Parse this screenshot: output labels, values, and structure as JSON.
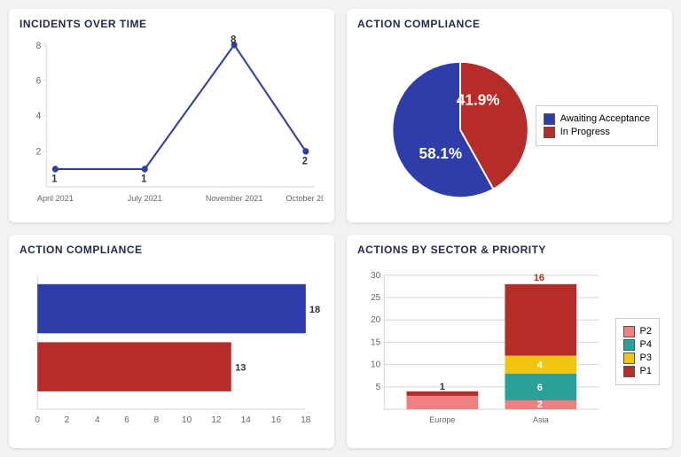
{
  "cards": {
    "incidents_over_time": {
      "title": "INCIDENTS OVER TIME"
    },
    "action_compliance_pie": {
      "title": "ACTION COMPLIANCE"
    },
    "action_compliance_bar": {
      "title": "ACTION COMPLIANCE"
    },
    "actions_by_sector": {
      "title": "ACTIONS BY SECTOR & PRIORITY"
    }
  },
  "pie_legend": {
    "awaiting": "Awaiting Acceptance",
    "in_progress": "In Progress"
  },
  "stack_legend": {
    "p1": "P1",
    "p2": "P2",
    "p3": "P3",
    "p4": "P4"
  },
  "chart_data": [
    {
      "type": "line",
      "title": "INCIDENTS OVER TIME",
      "categories": [
        "April 2021",
        "July 2021",
        "November 2021",
        "October 20"
      ],
      "values": [
        1,
        1,
        8,
        2
      ],
      "ylim": [
        0,
        8
      ],
      "yticks": [
        2,
        4,
        6,
        8
      ],
      "data_labels": [
        "1",
        "1",
        "8",
        "2"
      ],
      "color": "#2e3da9"
    },
    {
      "type": "pie",
      "title": "ACTION COMPLIANCE",
      "series": [
        {
          "name": "Awaiting Acceptance",
          "value": 58.1,
          "color": "#2e3da9",
          "label": "58.1%"
        },
        {
          "name": "In Progress",
          "value": 41.9,
          "color": "#b52c28",
          "label": "41.9%"
        }
      ],
      "legend_position": "right"
    },
    {
      "type": "bar",
      "orientation": "horizontal",
      "title": "ACTION COMPLIANCE",
      "series": [
        {
          "name": "Awaiting Acceptance",
          "value": 18,
          "color": "#2e3da9",
          "label": "18"
        },
        {
          "name": "In Progress",
          "value": 13,
          "color": "#b52c28",
          "label": "13"
        }
      ],
      "xlim": [
        0,
        18
      ],
      "xticks": [
        0,
        2,
        4,
        6,
        8,
        10,
        12,
        14,
        16,
        18
      ]
    },
    {
      "type": "bar",
      "subtype": "stacked",
      "title": "ACTIONS BY SECTOR & PRIORITY",
      "categories": [
        "Europe",
        "Asia"
      ],
      "series": [
        {
          "name": "P2",
          "color": "#f08080",
          "values": [
            3,
            2
          ]
        },
        {
          "name": "P4",
          "color": "#2aa198",
          "values": [
            0,
            6
          ]
        },
        {
          "name": "P3",
          "color": "#f1c40f",
          "values": [
            0,
            4
          ]
        },
        {
          "name": "P1",
          "color": "#b52c28",
          "values": [
            1,
            16
          ]
        }
      ],
      "ylim": [
        0,
        30
      ],
      "yticks": [
        5,
        10,
        15,
        20,
        25,
        30
      ],
      "totals_labels": {
        "Europe": "1",
        "Asia": "16"
      },
      "legend": [
        "P2",
        "P4",
        "P3",
        "P1"
      ]
    }
  ],
  "line": {
    "ytick0": "2",
    "ytick1": "4",
    "ytick2": "6",
    "ytick3": "8",
    "x0": "April 2021",
    "x1": "July 2021",
    "x2": "November 2021",
    "x3": "October 20",
    "d0": "1",
    "d1": "1",
    "d2": "8",
    "d3": "2"
  },
  "pie": {
    "pct_blue": "58.1%",
    "pct_red": "41.9%"
  },
  "hbar": {
    "xt0": "0",
    "xt1": "2",
    "xt2": "4",
    "xt3": "6",
    "xt4": "8",
    "xt5": "10",
    "xt6": "12",
    "xt7": "14",
    "xt8": "16",
    "xt9": "18",
    "d_blue": "18",
    "d_red": "13"
  },
  "stack": {
    "yt0": "5",
    "yt1": "10",
    "yt2": "15",
    "yt3": "20",
    "yt4": "25",
    "yt5": "30",
    "x0": "Europe",
    "x1": "Asia",
    "europe_top": "1",
    "asia_top": "16",
    "asia_p3": "4",
    "asia_p4": "6",
    "asia_p2": "2"
  }
}
